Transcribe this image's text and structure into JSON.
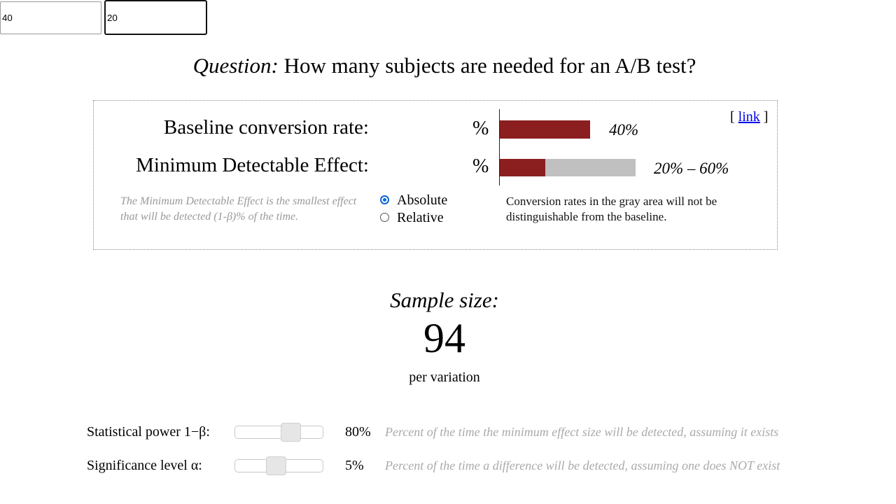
{
  "header": {
    "question_prefix": "Question:",
    "question_text": "How many subjects are needed for an A/B test?"
  },
  "panel": {
    "baseline": {
      "label": "Baseline conversion rate:",
      "value": "40",
      "unit": "%",
      "bar_fraction": 0.4,
      "bar_label": "40%"
    },
    "mde": {
      "label": "Minimum Detectable Effect:",
      "value": "20",
      "unit": "%",
      "range_low_fraction": 0.2,
      "range_high_fraction": 0.6,
      "range_label": "20% – 60%"
    },
    "link_open": "[",
    "link_text": "link",
    "link_close": "]",
    "mde_help": "The Minimum Detectable Effect is the smallest effect that will be detected (1-β)% of the time.",
    "mode_options": [
      {
        "label": "Absolute",
        "selected": true
      },
      {
        "label": "Relative",
        "selected": false
      }
    ],
    "gray_area_note": "Conversion rates in the gray area will not be distinguishable from the baseline."
  },
  "result": {
    "label": "Sample size:",
    "value": "94",
    "unit_text": "per variation"
  },
  "sliders": [
    {
      "label": "Statistical power 1−β:",
      "value_label": "80%",
      "value": 0.8,
      "help": "Percent of the time the minimum effect size will be detected, assuming it exists"
    },
    {
      "label": "Significance level α:",
      "value_label": "5%",
      "value": 0.05,
      "help": "Percent of the time a difference will be detected, assuming one does NOT exist"
    }
  ],
  "colors": {
    "bar_red": "#8b1f1f",
    "bar_gray": "#c0c0c0",
    "link_blue": "#0000ee",
    "radio_blue": "#0a66d8",
    "help_text": "#999999"
  }
}
